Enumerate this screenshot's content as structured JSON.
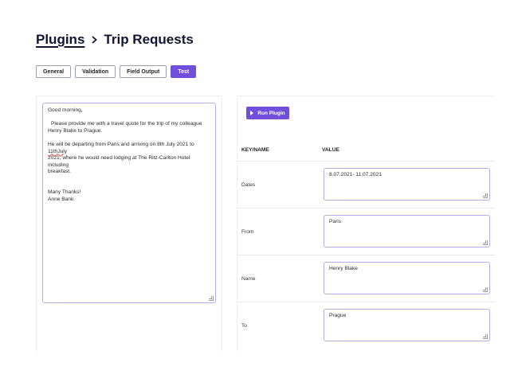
{
  "breadcrumb": {
    "root": "Plugins",
    "current": "Trip Requests"
  },
  "tabs": [
    {
      "label": "General",
      "active": false
    },
    {
      "label": "Validation",
      "active": false
    },
    {
      "label": "Field Output",
      "active": false
    },
    {
      "label": "Test",
      "active": true
    }
  ],
  "input_text": {
    "greeting": "Good morning,",
    "para1_line1": "Please provide me with a travel quote for the trip of my colleague",
    "para1_line2": "Henry Blake to Prague.",
    "para2_line1_a": "He will be departing from Paris and arriving on 8th July 2021 to ",
    "para2_line1_b": "11thJuly",
    "para2_line2": "2021, where he would need lodging at The Ritz-Carlton Hotel including",
    "para2_line3": "breakfast.",
    "signoff": "Many Thanks!",
    "signature": "Anne Bank"
  },
  "run_button": {
    "label": "Run Plugin"
  },
  "table": {
    "col_key": "KEY/NAME",
    "col_value": "VALUE",
    "rows": [
      {
        "key": "Dates",
        "value": "8.07.2021- 11.07.2021"
      },
      {
        "key": "From",
        "value": "Paris"
      },
      {
        "key": "Name",
        "value": "Henry Blake"
      },
      {
        "key": "To",
        "value": "Prague"
      }
    ]
  },
  "colors": {
    "accent": "#6f4fdc",
    "input_border": "#b6aee8"
  }
}
